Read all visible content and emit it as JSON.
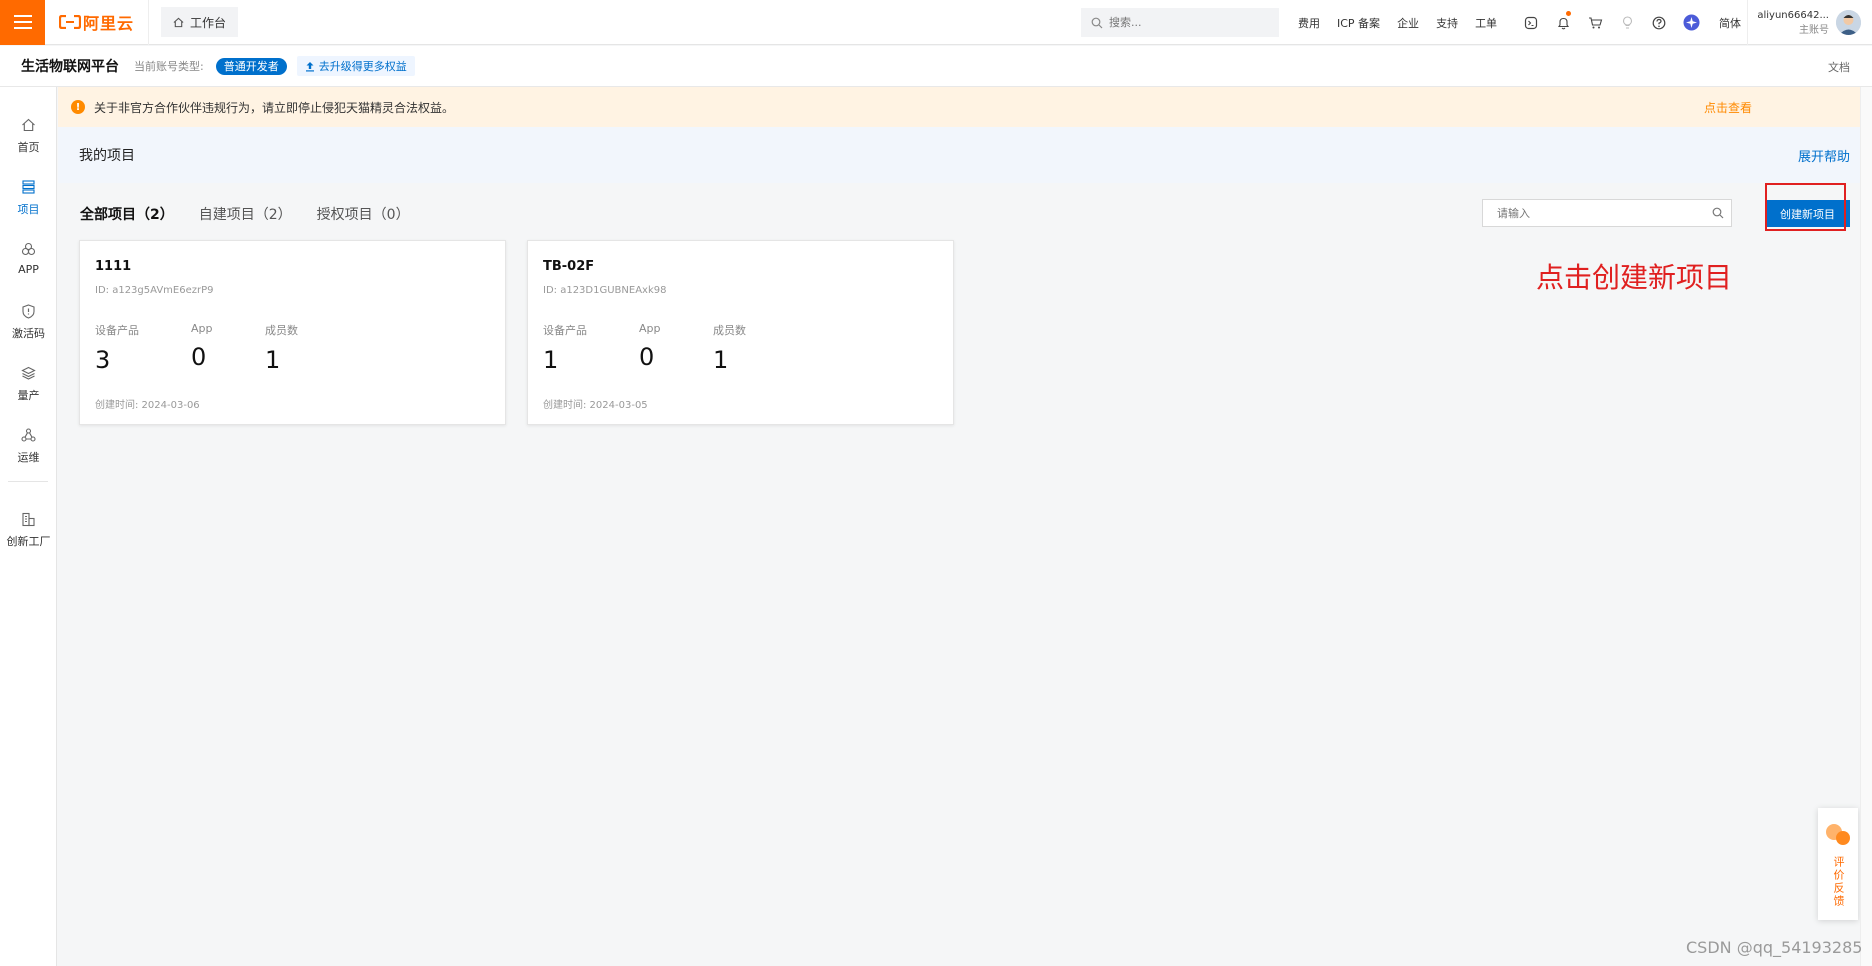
{
  "topbar": {
    "logo_text": "阿里云",
    "workbench": "工作台",
    "search_placeholder": "搜索...",
    "links": [
      "费用",
      "ICP 备案",
      "企业",
      "支持",
      "工单"
    ],
    "language": "简体",
    "user_name": "aliyun66642...",
    "user_role": "主账号",
    "brand_color": "#ff6a00"
  },
  "subbar": {
    "platform_name": "生活物联网平台",
    "account_type_label": "当前账号类型:",
    "account_type": "普通开发者",
    "upgrade_text": "去升级得更多权益",
    "docs": "文档"
  },
  "sidebar": {
    "items": [
      {
        "label": "首页",
        "icon": "home-icon"
      },
      {
        "label": "项目",
        "icon": "project-icon"
      },
      {
        "label": "APP",
        "icon": "app-icon"
      },
      {
        "label": "激活码",
        "icon": "shield-icon"
      },
      {
        "label": "量产",
        "icon": "layers-icon"
      },
      {
        "label": "运维",
        "icon": "ops-icon"
      },
      {
        "label": "创新工厂",
        "icon": "factory-icon"
      }
    ],
    "active": "项目"
  },
  "notice": {
    "text": "关于非官方合作伙伴违规行为，请立即停止侵犯天猫精灵合法权益。",
    "link": "点击查看"
  },
  "page": {
    "title": "我的项目",
    "help": "展开帮助",
    "tabs": [
      "全部项目（2）",
      "自建项目（2）",
      "授权项目（0）"
    ],
    "search_placeholder": "请输入",
    "create_button": "创建新项目",
    "annotation": "点击创建新项目",
    "accent_color": "#0070cc",
    "annotation_color": "#e02020"
  },
  "projects": [
    {
      "name": "1111",
      "id": "ID: a123g5AVmE6ezrP9",
      "stat_labels": [
        "设备产品",
        "App",
        "成员数"
      ],
      "stat_values": [
        "3",
        "0",
        "1"
      ],
      "created": "创建时间: 2024-03-06"
    },
    {
      "name": "TB-02F",
      "id": "ID: a123D1GUBNEAxk98",
      "stat_labels": [
        "设备产品",
        "App",
        "成员数"
      ],
      "stat_values": [
        "1",
        "0",
        "1"
      ],
      "created": "创建时间: 2024-03-05"
    }
  ],
  "feedback": "评价反馈",
  "watermark": "CSDN @qq_54193285"
}
